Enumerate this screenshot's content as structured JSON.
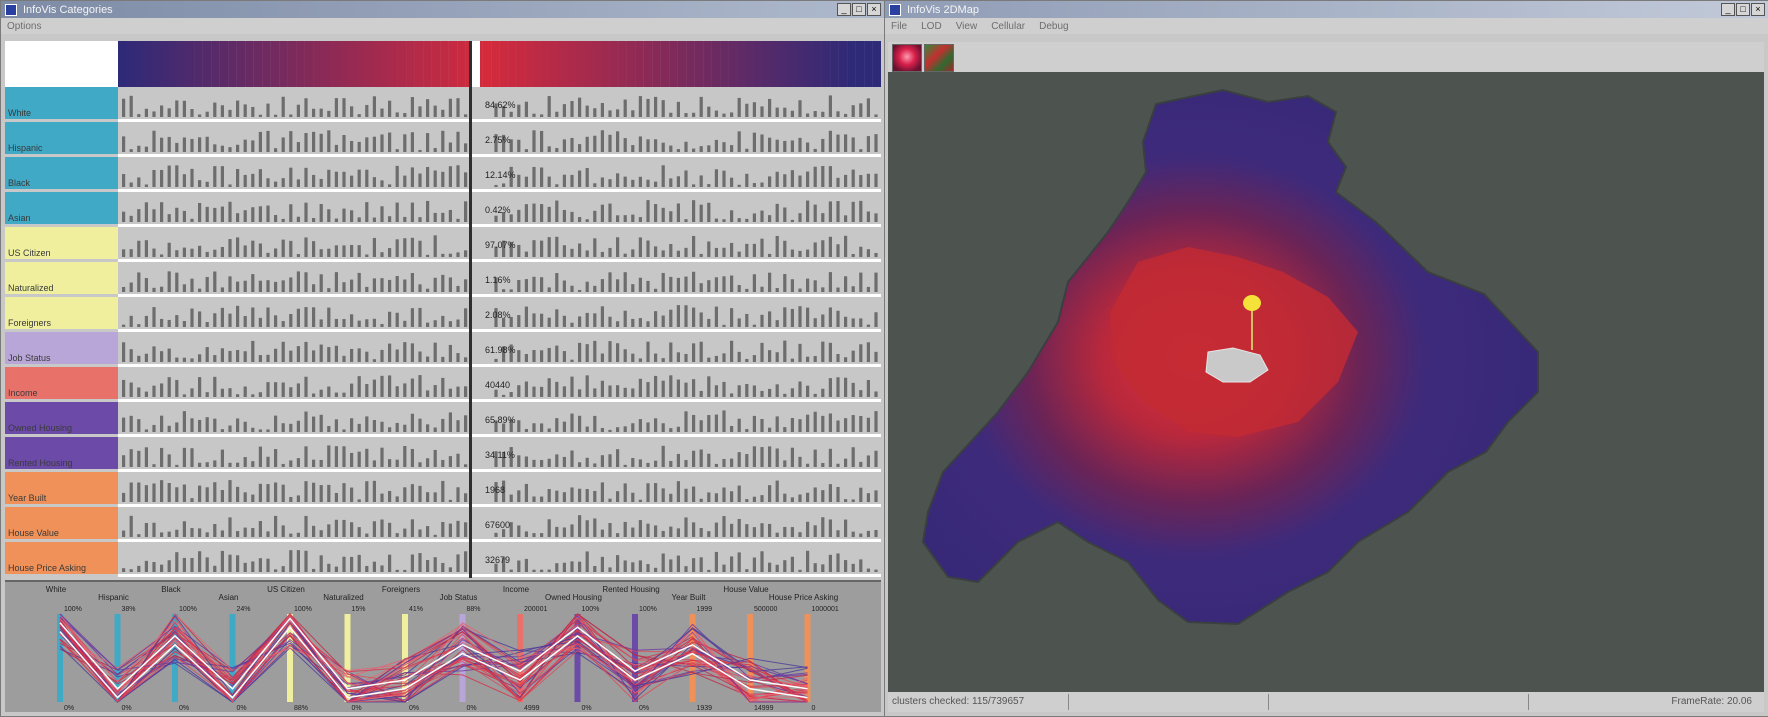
{
  "left_window": {
    "title": "InfoVis Categories",
    "menu": [
      "Options"
    ],
    "rows": [
      {
        "label": "White",
        "pct": "84.62%",
        "color": "#3fa9c6"
      },
      {
        "label": "Hispanic",
        "pct": "2.75%",
        "color": "#3fa9c6"
      },
      {
        "label": "Black",
        "pct": "12.14%",
        "color": "#3fa9c6"
      },
      {
        "label": "Asian",
        "pct": "0.42%",
        "color": "#3fa9c6"
      },
      {
        "label": "US Citizen",
        "pct": "97.07%",
        "color": "#efef9e"
      },
      {
        "label": "Naturalized",
        "pct": "1.16%",
        "color": "#efef9e"
      },
      {
        "label": "Foreigners",
        "pct": "2.08%",
        "color": "#efef9e"
      },
      {
        "label": "Job Status",
        "pct": "61.98%",
        "color": "#b8a6d8"
      },
      {
        "label": "Income",
        "pct": "40440",
        "color": "#e8726a"
      },
      {
        "label": "Owned Housing",
        "pct": "65.89%",
        "color": "#6c4ba8"
      },
      {
        "label": "Rented Housing",
        "pct": "34.11%",
        "color": "#6c4ba8"
      },
      {
        "label": "Year Built",
        "pct": "1968",
        "color": "#ef9158"
      },
      {
        "label": "House Value",
        "pct": "67600",
        "color": "#ef9158"
      },
      {
        "label": "House Price Asking",
        "pct": "32679",
        "color": "#ef9158"
      }
    ],
    "parallel": {
      "axes": [
        {
          "label": "White",
          "top": "100%",
          "bottom": "0%",
          "color": "#3fa9c6"
        },
        {
          "label": "Hispanic",
          "top": "38%",
          "bottom": "0%",
          "color": "#3fa9c6"
        },
        {
          "label": "Black",
          "top": "100%",
          "bottom": "0%",
          "color": "#3fa9c6"
        },
        {
          "label": "Asian",
          "top": "24%",
          "bottom": "0%",
          "color": "#3fa9c6"
        },
        {
          "label": "US Citizen",
          "top": "100%",
          "bottom": "88%",
          "color": "#efef9e"
        },
        {
          "label": "Naturalized",
          "top": "15%",
          "bottom": "0%",
          "color": "#efef9e"
        },
        {
          "label": "Foreigners",
          "top": "41%",
          "bottom": "0%",
          "color": "#efef9e"
        },
        {
          "label": "Job Status",
          "top": "88%",
          "bottom": "0%",
          "color": "#b8a6d8"
        },
        {
          "label": "Income",
          "top": "200001",
          "bottom": "4999",
          "color": "#e8726a"
        },
        {
          "label": "Owned Housing",
          "top": "100%",
          "bottom": "0%",
          "color": "#6c4ba8"
        },
        {
          "label": "Rented Housing",
          "top": "100%",
          "bottom": "0%",
          "color": "#6c4ba8"
        },
        {
          "label": "Year Built",
          "top": "1999",
          "bottom": "1939",
          "color": "#ef9158"
        },
        {
          "label": "House Value",
          "top": "500000",
          "bottom": "14999",
          "color": "#ef9158"
        },
        {
          "label": "House Price Asking",
          "top": "1000001",
          "bottom": "0",
          "color": "#ef9158"
        }
      ]
    }
  },
  "right_window": {
    "title": "InfoVis 2DMap",
    "menu": [
      "File",
      "LOD",
      "View",
      "Cellular",
      "Debug"
    ],
    "status": {
      "left": "clusters checked: 115/739657",
      "right": "FrameRate: 20.06"
    }
  },
  "colors": {
    "strip_low": "#2e2a78",
    "strip_high": "#d42a3c",
    "map_bg": "#4d5450",
    "map_outer": "#3f2a7a",
    "map_inner": "#b5283a"
  }
}
